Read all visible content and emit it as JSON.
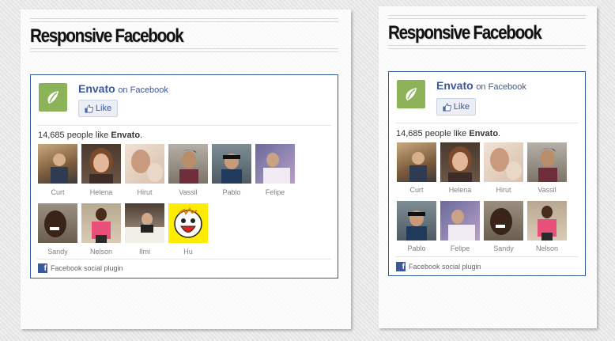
{
  "widget_a": {
    "title": "Responsive Facebook",
    "page_name": "Envato",
    "on_facebook": "on Facebook",
    "like_label": "Like",
    "count_prefix": "14,685 people like",
    "count_page": "Envato",
    "count_suffix": ".",
    "footer": "Facebook social plugin",
    "faces": [
      "Curt",
      "Helena",
      "Hirut",
      "Vassil",
      "Pablo",
      "Felipe",
      "Sandy",
      "Nelson",
      "Ilmi",
      "Hu"
    ]
  },
  "widget_b": {
    "title": "Responsive Facebook",
    "page_name": "Envato",
    "on_facebook": "on Facebook",
    "like_label": "Like",
    "count_prefix": "14,685 people like",
    "count_page": "Envato",
    "count_suffix": ".",
    "footer": "Facebook social plugin",
    "faces": [
      "Curt",
      "Helena",
      "Hirut",
      "Vassil",
      "Pablo",
      "Felipe",
      "Sandy",
      "Nelson"
    ]
  },
  "colors": {
    "facebook_blue": "#3b5998",
    "envato_green": "#8cb35a"
  }
}
